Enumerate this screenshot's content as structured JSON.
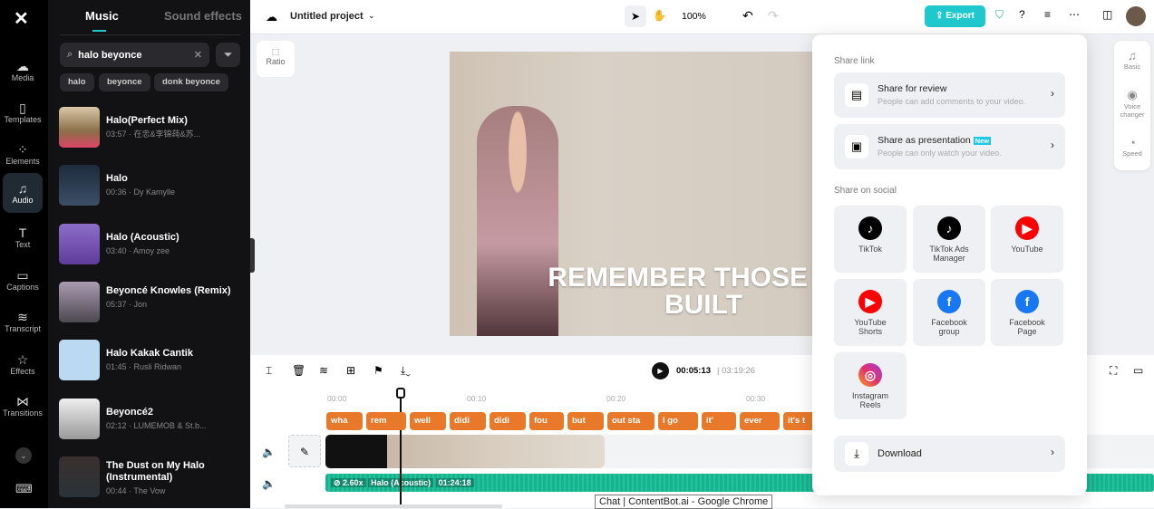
{
  "rail": {
    "items": [
      {
        "label": "Media",
        "icon": "cloud-upload-icon"
      },
      {
        "label": "Templates",
        "icon": "templates-icon"
      },
      {
        "label": "Elements",
        "icon": "elements-icon"
      },
      {
        "label": "Audio",
        "icon": "music-note-icon",
        "active": true
      },
      {
        "label": "Text",
        "icon": "text-icon"
      },
      {
        "label": "Captions",
        "icon": "captions-icon"
      },
      {
        "label": "Transcript",
        "icon": "transcript-icon"
      },
      {
        "label": "Effects",
        "icon": "effects-icon"
      },
      {
        "label": "Transitions",
        "icon": "transitions-icon"
      }
    ]
  },
  "panel": {
    "tabs": [
      "Music",
      "Sound effects"
    ],
    "search_value": "halo beyonce",
    "chips": [
      "halo",
      "beyonce",
      "donk beyonce"
    ],
    "songs": [
      {
        "title": "Halo(Perfect Mix)",
        "meta": "03:57 · 在忠&李锦莼&苏..."
      },
      {
        "title": "Halo",
        "meta": "00:36 · Dy Kamylle"
      },
      {
        "title": "Halo (Acoustic)",
        "meta": "03:40 · Amoy zee"
      },
      {
        "title": "Beyoncé Knowles (Remix)",
        "meta": "05:37 · Jon"
      },
      {
        "title": "Halo Kakak Cantik",
        "meta": "01:45 · Rusli Ridwan"
      },
      {
        "title": "Beyoncé2",
        "meta": "02:12 · LUMEMOB & St.b..."
      },
      {
        "title": "The Dust on My Halo (Instrumental)",
        "meta": "00:44 · The Vow"
      }
    ]
  },
  "topbar": {
    "project": "Untitled project",
    "zoom": "100%",
    "export": "Export"
  },
  "canvas": {
    "ratio": "Ratio",
    "caption_line1": "REMEMBER THOSE WA",
    "caption_line2": "BUILT"
  },
  "timeline": {
    "current": "00:05:13",
    "total": "03:19:26",
    "ticks": [
      "00:00",
      "00:10",
      "00:20",
      "00:30"
    ],
    "captions": [
      "wha",
      "rem",
      "well",
      "didi",
      "didi",
      "fou",
      "but",
      "out sta",
      "I go",
      "it'",
      "ever",
      "it's t",
      ""
    ],
    "audio_speed": "2.60x",
    "audio_name": "Halo (Acoustic)",
    "audio_duration": "01:24:18",
    "tooltip": "Chat | ContentBot.ai - Google Chrome"
  },
  "share": {
    "link_heading": "Share link",
    "review_title": "Share for review",
    "review_sub": "People can add comments to your video.",
    "pres_title": "Share as presentation",
    "pres_badge": "New",
    "pres_sub": "People can only watch your video.",
    "social_heading": "Share on social",
    "social": [
      {
        "label": "TikTok",
        "color": "#000000"
      },
      {
        "label": "TikTok Ads Manager",
        "color": "#000000"
      },
      {
        "label": "YouTube",
        "color": "#ff0000"
      },
      {
        "label": "YouTube Shorts",
        "color": "#ff0000"
      },
      {
        "label": "Facebook group",
        "color": "#1877f2"
      },
      {
        "label": "Facebook Page",
        "color": "#1877f2"
      },
      {
        "label": "Instagram Reels",
        "color": "#e1306c"
      }
    ],
    "download": "Download"
  },
  "right_panel": {
    "items": [
      "Basic",
      "Voice changer",
      "Speed"
    ]
  }
}
